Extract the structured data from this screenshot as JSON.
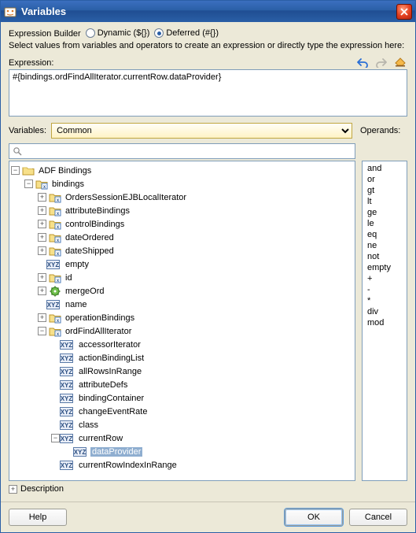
{
  "window": {
    "title": "Variables"
  },
  "builder": {
    "label": "Expression Builder",
    "dynamic_label": "Dynamic (${})",
    "deferred_label": "Deferred (#{})",
    "selected": "deferred",
    "hint": "Select values from variables and operators to create an expression or directly type the expression here:",
    "expression_label": "Expression:",
    "expression_value": "#{bindings.ordFindAllIterator.currentRow.dataProvider}"
  },
  "variables": {
    "label": "Variables:",
    "selected": "Common",
    "operands_label": "Operands:",
    "search_placeholder": ""
  },
  "tree": {
    "root": {
      "label": "ADF Bindings",
      "children": [
        {
          "label": "bindings",
          "children": [
            {
              "label": "OrdersSessionEJBLocalIterator"
            },
            {
              "label": "attributeBindings"
            },
            {
              "label": "controlBindings"
            },
            {
              "label": "dateOrdered"
            },
            {
              "label": "dateShipped"
            },
            {
              "label": "empty",
              "leaf": true
            },
            {
              "label": "id"
            },
            {
              "label": "mergeOrd"
            },
            {
              "label": "name",
              "leaf": true
            },
            {
              "label": "operationBindings"
            },
            {
              "label": "ordFindAllIterator",
              "children": [
                {
                  "label": "accessorIterator",
                  "leaf": true
                },
                {
                  "label": "actionBindingList",
                  "leaf": true
                },
                {
                  "label": "allRowsInRange",
                  "leaf": true
                },
                {
                  "label": "attributeDefs",
                  "leaf": true
                },
                {
                  "label": "bindingContainer",
                  "leaf": true
                },
                {
                  "label": "changeEventRate",
                  "leaf": true
                },
                {
                  "label": "class",
                  "leaf": true
                },
                {
                  "label": "currentRow",
                  "children": [
                    {
                      "label": "dataProvider",
                      "leaf": true,
                      "selected": true
                    }
                  ]
                },
                {
                  "label": "currentRowIndexInRange",
                  "leaf": true
                }
              ]
            }
          ]
        }
      ]
    }
  },
  "operands": [
    "and",
    "or",
    "gt",
    "lt",
    "ge",
    "le",
    "eq",
    "ne",
    "not",
    "empty",
    "+",
    "-",
    "*",
    "div",
    "mod"
  ],
  "description": {
    "label": "Description"
  },
  "buttons": {
    "help": "Help",
    "ok": "OK",
    "cancel": "Cancel"
  }
}
